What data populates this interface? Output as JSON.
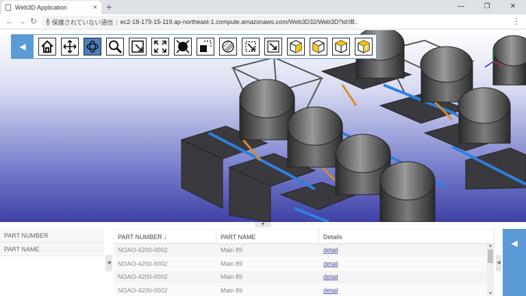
{
  "browser": {
    "tab_title": "Web3D Application",
    "tab_close": "×",
    "new_tab": "+",
    "window_buttons": [
      "—",
      "❐",
      "✕"
    ],
    "security_text": "保護されていない通信",
    "url": "ec2-18-179-15-119.ap-northeast-1.compute.amazonaws.com/Web3D32/Web3D?id=B...",
    "separator": "|"
  },
  "toolbar": {
    "collapse_glyph": "◀",
    "buttons": [
      {
        "icon": "home-icon"
      },
      {
        "icon": "pan-icon"
      },
      {
        "icon": "rotate-icon",
        "active": true
      },
      {
        "icon": "zoom-icon"
      },
      {
        "icon": "zoom-window-icon"
      },
      {
        "icon": "fit-all-icon"
      },
      {
        "icon": "select-mode-icon"
      },
      {
        "icon": "hide-part-icon"
      },
      {
        "icon": "section-icon"
      },
      {
        "icon": "measure-box-icon"
      },
      {
        "icon": "measure-point-icon"
      },
      {
        "icon": "view-iso-1-icon"
      },
      {
        "icon": "view-iso-2-icon"
      },
      {
        "icon": "view-iso-3-icon"
      },
      {
        "icon": "view-iso-4-icon"
      }
    ]
  },
  "viewport": {
    "accent": "#5b9bd5",
    "background_top": "#ffffff",
    "background_bottom": "#3e41a3"
  },
  "split_handle": "▼",
  "filters": {
    "items": [
      "PART NUMBER",
      "PART NAME"
    ],
    "handle": "◀"
  },
  "grid": {
    "columns": [
      "PART NUMBER ↓",
      "PART NAME",
      "Details"
    ],
    "rows": [
      {
        "part_number": "NOAO-4200-0002",
        "part_name": "Main 89",
        "details": "detail"
      },
      {
        "part_number": "NOAO-4200-0002",
        "part_name": "Main 89",
        "details": "detail"
      },
      {
        "part_number": "NOAO-4200-0002",
        "part_name": "Main 89",
        "details": "detail"
      },
      {
        "part_number": "NOAO-4200-0002",
        "part_name": "Main 89",
        "details": "detail"
      }
    ]
  },
  "right_panel": {
    "handle": "◀",
    "expand": "◀"
  }
}
